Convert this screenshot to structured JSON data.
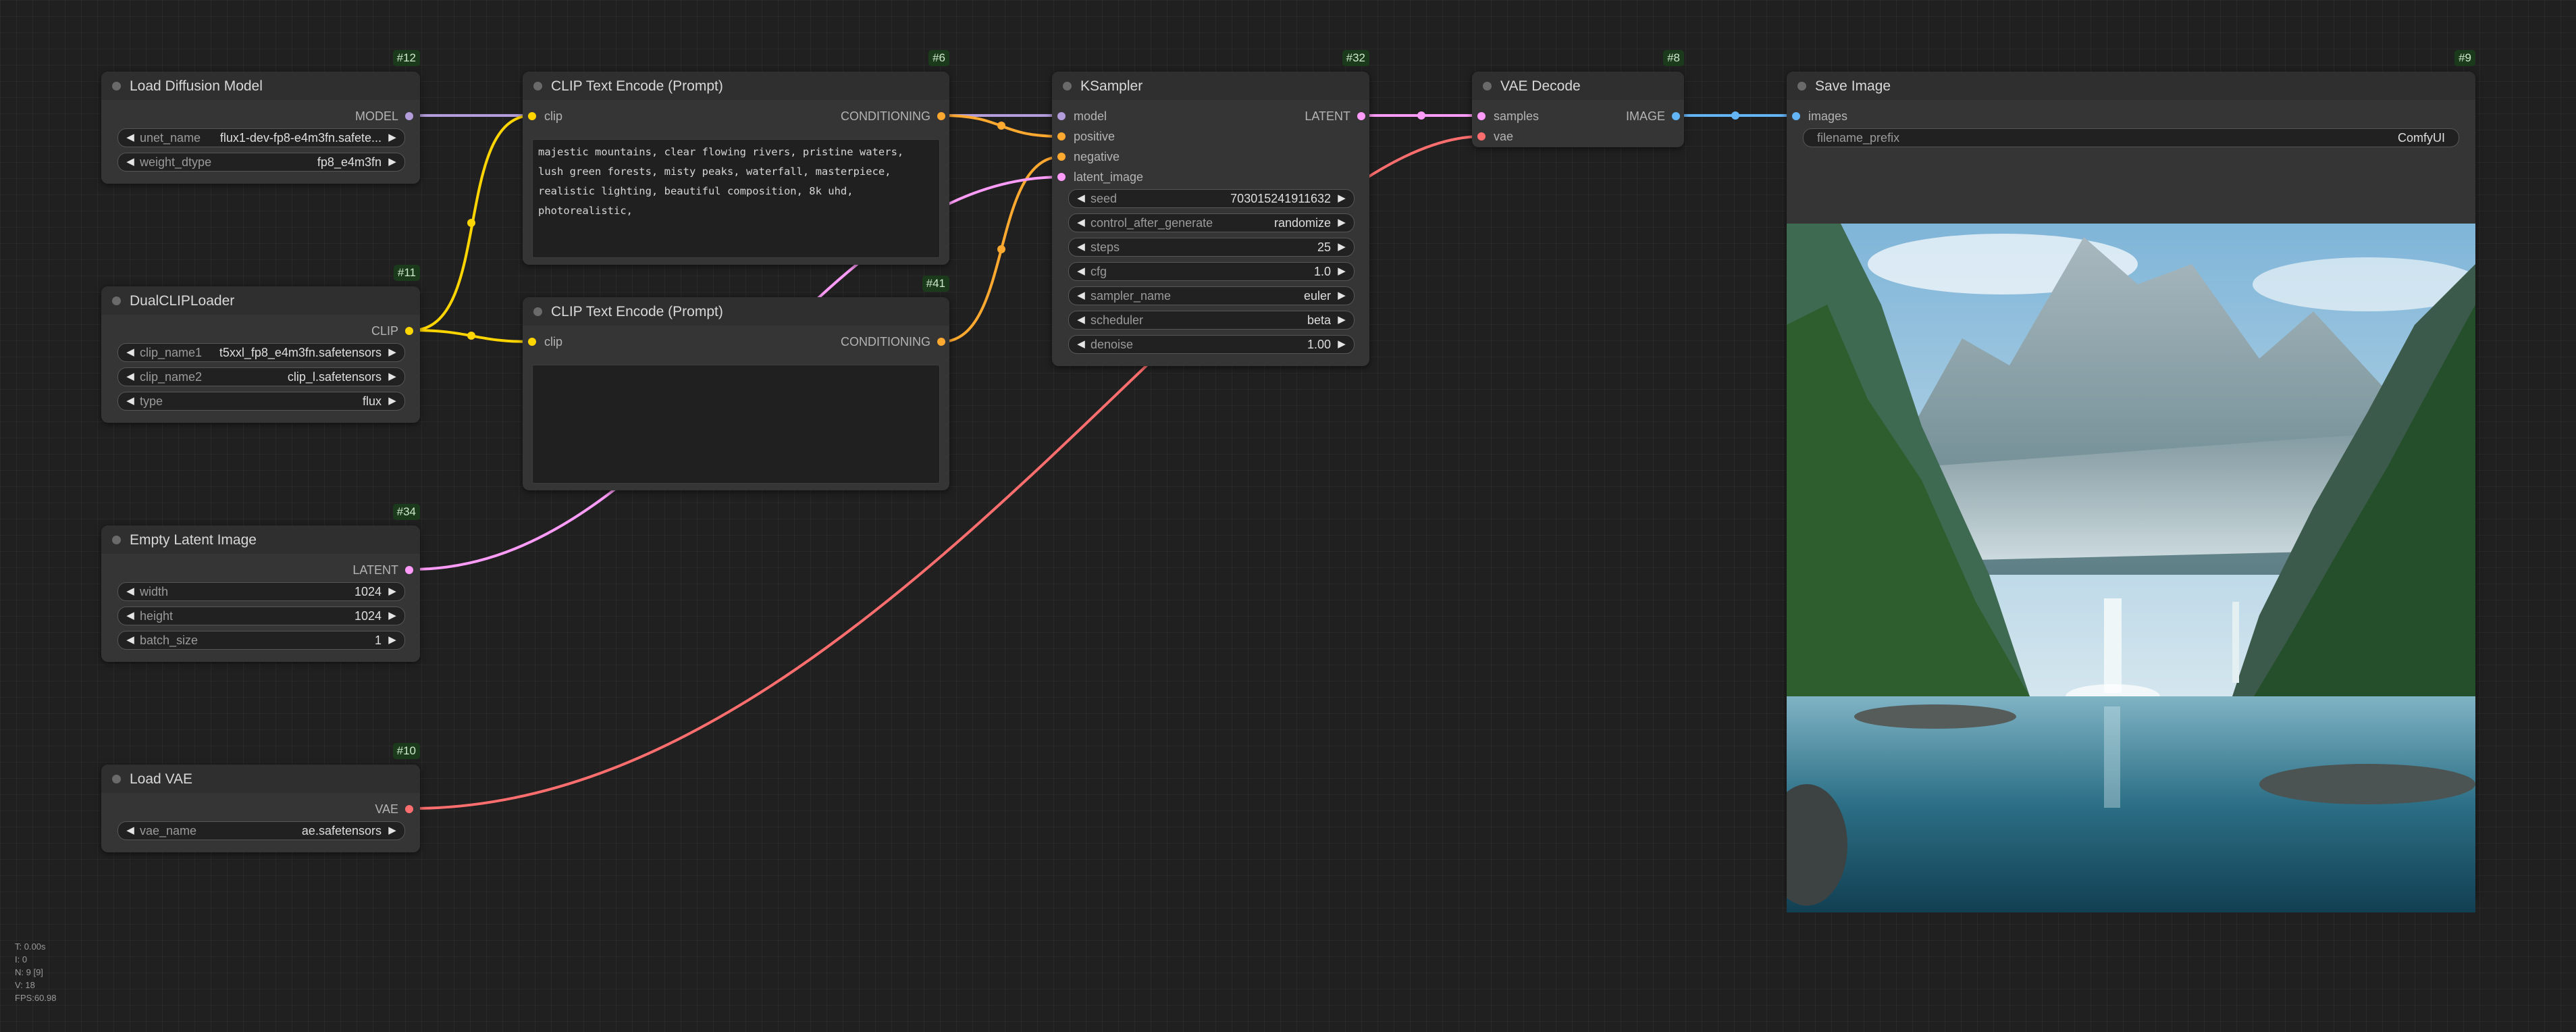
{
  "nodes": {
    "load_diffusion": {
      "id": "#12",
      "title": "Load Diffusion Model",
      "output": "MODEL",
      "widgets": [
        {
          "name": "unet_name",
          "value": "flux1-dev-fp8-e4m3fn.safete..."
        },
        {
          "name": "weight_dtype",
          "value": "fp8_e4m3fn"
        }
      ]
    },
    "dual_clip": {
      "id": "#11",
      "title": "DualCLIPLoader",
      "output": "CLIP",
      "widgets": [
        {
          "name": "clip_name1",
          "value": "t5xxl_fp8_e4m3fn.safetensors"
        },
        {
          "name": "clip_name2",
          "value": "clip_l.safetensors"
        },
        {
          "name": "type",
          "value": "flux"
        }
      ]
    },
    "empty_latent": {
      "id": "#34",
      "title": "Empty Latent Image",
      "output": "LATENT",
      "widgets": [
        {
          "name": "width",
          "value": "1024"
        },
        {
          "name": "height",
          "value": "1024"
        },
        {
          "name": "batch_size",
          "value": "1"
        }
      ]
    },
    "load_vae": {
      "id": "#10",
      "title": "Load VAE",
      "output": "VAE",
      "widgets": [
        {
          "name": "vae_name",
          "value": "ae.safetensors"
        }
      ]
    },
    "clip_pos": {
      "id": "#6",
      "title": "CLIP Text Encode (Prompt)",
      "input": "clip",
      "output": "CONDITIONING",
      "text": "majestic mountains, clear flowing rivers, pristine waters, lush green forests, misty peaks, waterfall, masterpiece, realistic lighting, beautiful composition, 8k uhd, photorealistic,"
    },
    "clip_neg": {
      "id": "#41",
      "title": "CLIP Text Encode (Prompt)",
      "input": "clip",
      "output": "CONDITIONING",
      "text": ""
    },
    "ksampler": {
      "id": "#32",
      "title": "KSampler",
      "inputs": [
        "model",
        "positive",
        "negative",
        "latent_image"
      ],
      "output": "LATENT",
      "widgets": [
        {
          "name": "seed",
          "value": "703015241911632"
        },
        {
          "name": "control_after_generate",
          "value": "randomize"
        },
        {
          "name": "steps",
          "value": "25"
        },
        {
          "name": "cfg",
          "value": "1.0"
        },
        {
          "name": "sampler_name",
          "value": "euler"
        },
        {
          "name": "scheduler",
          "value": "beta"
        },
        {
          "name": "denoise",
          "value": "1.00"
        }
      ]
    },
    "vae_decode": {
      "id": "#8",
      "title": "VAE Decode",
      "inputs": [
        "samples",
        "vae"
      ],
      "output": "IMAGE"
    },
    "save_image": {
      "id": "#9",
      "title": "Save Image",
      "input": "images",
      "widgets": [
        {
          "name": "filename_prefix",
          "value": "ComfyUI"
        }
      ]
    }
  },
  "stats": [
    "T: 0.00s",
    "I: 0",
    "N: 9 [9]",
    "V: 18",
    "FPS:60.98"
  ],
  "colors": {
    "model": "#b39ddb",
    "clip": "#ffd500",
    "conditioning": "#ffa931",
    "latent": "#ff9cf9",
    "vae": "#ff6e6e",
    "image": "#64b5f6",
    "badge_bg": "#1b3a1b"
  }
}
